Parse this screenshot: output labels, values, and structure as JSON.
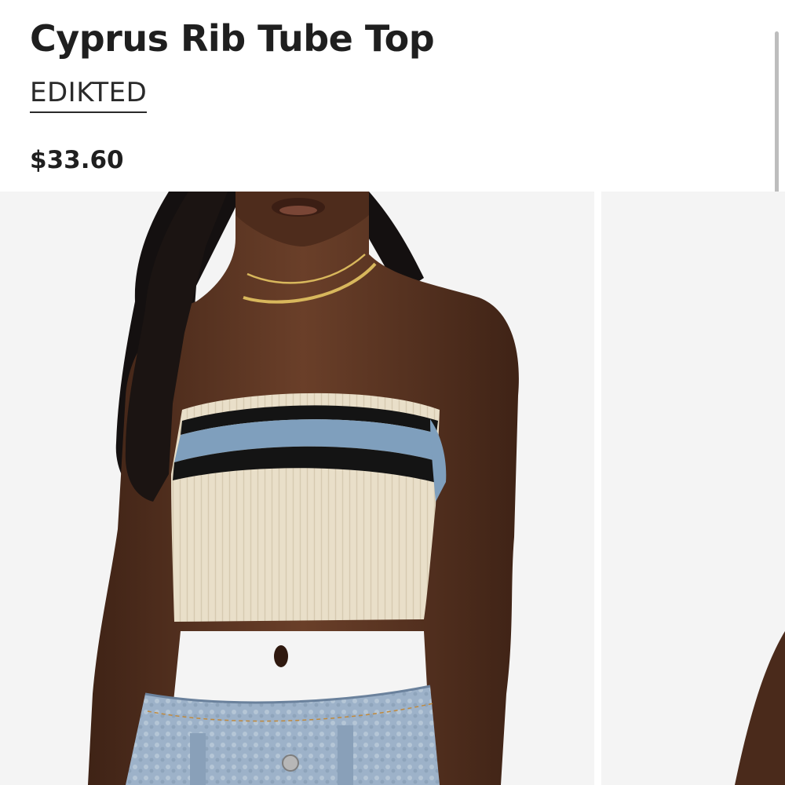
{
  "product": {
    "title": "Cyprus Rib Tube Top",
    "brand": "EDIKTED",
    "price": "$33.60"
  },
  "colors": {
    "title_text": "#1f1f1f",
    "image_background": "#f4f4f4",
    "top_cream": "#e9dfc9",
    "stripe_blue": "#7f9fbd",
    "stripe_black": "#141414",
    "denim": "#9db2c9",
    "skin": "#5a3422",
    "hair": "#141010"
  },
  "gallery": {
    "image_count_visible": 2
  }
}
